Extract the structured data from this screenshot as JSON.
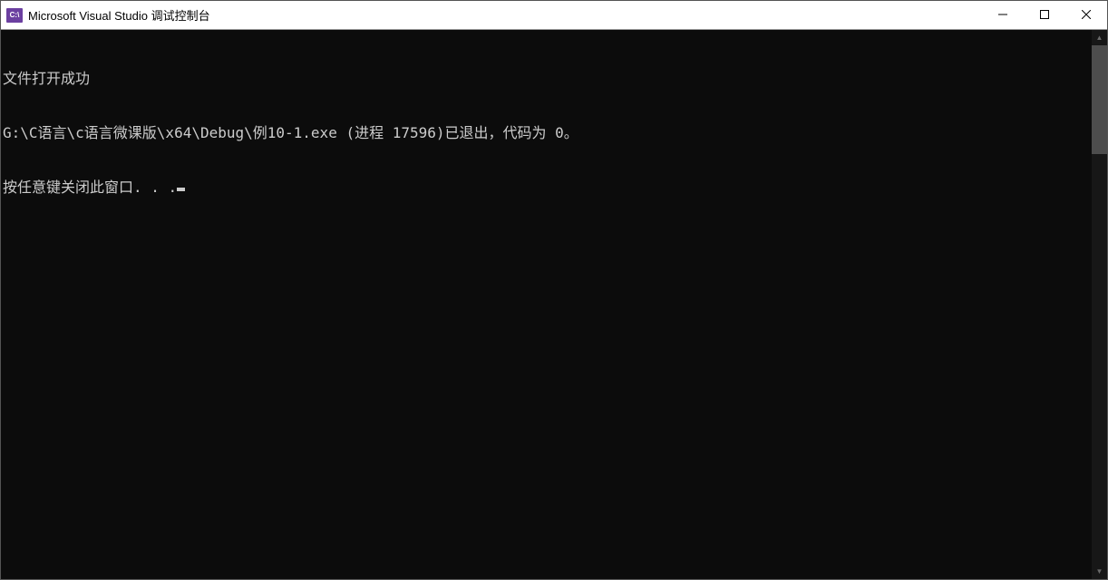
{
  "window": {
    "icon_label": "C:\\",
    "title": "Microsoft Visual Studio 调试控制台"
  },
  "console": {
    "lines": [
      "文件打开成功",
      "G:\\C语言\\c语言微课版\\x64\\Debug\\例10-1.exe (进程 17596)已退出，代码为 0。",
      "按任意键关闭此窗口. . ."
    ]
  }
}
